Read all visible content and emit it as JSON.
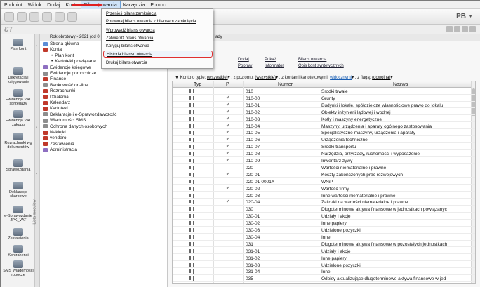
{
  "menubar": {
    "items": [
      {
        "label": "Podmiot"
      },
      {
        "label": "Widok"
      },
      {
        "label": "Dodaj"
      },
      {
        "label": "Konto"
      },
      {
        "label": "Bilans otwarcia",
        "active": true
      },
      {
        "label": "Narzędzia"
      },
      {
        "label": "Pomoc"
      }
    ]
  },
  "toolbar": {
    "profile_label": "PB"
  },
  "context": {
    "year_label": "Rok obrotowy - 2021  (od 0",
    "trail": "ady"
  },
  "modules": [
    {
      "label": "Plan kont",
      "icon": "chart-of-accounts-icon"
    },
    {
      "label": "Dekretacja i księgowanie",
      "icon": "posting-icon"
    },
    {
      "label": "Ewidencja VAT sprzedaży",
      "icon": "vat-sales-icon"
    },
    {
      "label": "Ewidencja VAT zakupu",
      "icon": "vat-purchase-icon"
    },
    {
      "label": "Rozrachunki wg dokumentów",
      "icon": "settlements-icon"
    },
    {
      "label": "Sprawozdania",
      "icon": "reports-icon"
    },
    {
      "label": "Deklaracje skarbowe",
      "icon": "tax-declarations-icon"
    },
    {
      "label": "e-Sprawozdanie JPK_VAT",
      "icon": "e-report-icon"
    },
    {
      "label": "Zestawienia",
      "icon": "summaries-icon"
    },
    {
      "label": "Kontrahenci",
      "icon": "contractors-icon"
    },
    {
      "label": "SMS Wiadomości robocze",
      "icon": "sms-icon"
    }
  ],
  "module_tab_label": "Lista modułów",
  "tree": {
    "items": [
      {
        "label": "Strona główna",
        "indent": 0,
        "color": "#5b8dd6"
      },
      {
        "label": "Konta",
        "indent": 0,
        "color": "#c0392b"
      },
      {
        "label": "Plan kont",
        "indent": 2,
        "color": ""
      },
      {
        "label": "Kartoteki powiązane",
        "indent": 2,
        "color": ""
      },
      {
        "label": "Ewidencje księgowe",
        "indent": 0,
        "color": "#8e6fc1"
      },
      {
        "label": "Ewidencje pomocnicze",
        "indent": 0,
        "color": "#8e8e8e"
      },
      {
        "label": "Finanse",
        "indent": 0,
        "color": "#c0392b"
      },
      {
        "label": "Bankowość on-line",
        "indent": 0,
        "color": "#8e8e8e"
      },
      {
        "label": "Rozrachunki",
        "indent": 0,
        "color": "#c0392b"
      },
      {
        "label": "Działania",
        "indent": 0,
        "color": "#c0392b"
      },
      {
        "label": "Kalendarz",
        "indent": 0,
        "color": "#c0392b"
      },
      {
        "label": "Kartoteki",
        "indent": 0,
        "color": "#c0392b"
      },
      {
        "label": "Deklaracje i e-Sprawozdawczość",
        "indent": 0,
        "color": "#8e8e8e"
      },
      {
        "label": "Wiadomości SMS",
        "indent": 0,
        "color": "#8e8e8e"
      },
      {
        "label": "Ochrona danych osobowych",
        "indent": 0,
        "color": "#8e8e8e"
      },
      {
        "label": "Naklejki",
        "indent": 0,
        "color": "#c0392b"
      },
      {
        "label": "vendero",
        "indent": 0,
        "color": "#c0392b"
      },
      {
        "label": "Zestawienia",
        "indent": 0,
        "color": "#c0392b"
      },
      {
        "label": "Administracja",
        "indent": 0,
        "color": "#8e6fc1"
      }
    ]
  },
  "actions": {
    "dodaj": "Dodaj",
    "popraw": "Popraw",
    "pokaz": "Pokaż",
    "informator": "Informator",
    "bilans_otwarcia": "Bilans otwarcia",
    "opis_kont": "Opis kont syntetycznych"
  },
  "filter": {
    "label_type": "Konto o typie:",
    "type_value": "(wszystkie)",
    "label_level": ", z poziomu:",
    "level_value": "(wszystkie)",
    "label_card": ", z kontami kartotekowymi:",
    "card_value": "widocznymi",
    "label_flag": ", z flagą:",
    "flag_value": "(dowolna)"
  },
  "grid": {
    "columns": {
      "typ": "Typ",
      "p": "P",
      "numer": "Numer",
      "nazwa": "Nazwa"
    },
    "rows": [
      {
        "checked": false,
        "numer": "010",
        "nazwa": "Środki trwałe"
      },
      {
        "checked": true,
        "numer": "010-00",
        "nazwa": "Grunty"
      },
      {
        "checked": true,
        "numer": "010-01",
        "nazwa": "Budynki i lokale, spółdzielcze własnościowe prawo do lokalu"
      },
      {
        "checked": true,
        "numer": "010-02",
        "nazwa": "Obiekty inżynierii lądowej i wodnej"
      },
      {
        "checked": true,
        "numer": "010-03",
        "nazwa": "Kotły i maszyny energetyczne"
      },
      {
        "checked": true,
        "numer": "010-04",
        "nazwa": "Maszyny, urządzenia i aparaty ogólnego zastosowania"
      },
      {
        "checked": true,
        "numer": "010-05",
        "nazwa": "Specjalistyczne maszyny, urządzenia i aparaty"
      },
      {
        "checked": true,
        "numer": "010-06",
        "nazwa": "Urządzenia techniczne"
      },
      {
        "checked": true,
        "numer": "010-07",
        "nazwa": "Środki transportu"
      },
      {
        "checked": true,
        "numer": "010-08",
        "nazwa": "Narzędzia, przyrządy, ruchomości i wyposażenie"
      },
      {
        "checked": true,
        "numer": "010-09",
        "nazwa": "Inwentarz żywy"
      },
      {
        "checked": false,
        "numer": "020",
        "nazwa": "Wartości niematerialne i prawne"
      },
      {
        "checked": true,
        "numer": "020-01",
        "nazwa": "Koszty zakończonych prac rozwojowych"
      },
      {
        "checked": false,
        "numer": "020-01-0001X",
        "nazwa": "WNiP"
      },
      {
        "checked": true,
        "numer": "020-02",
        "nazwa": "Wartość firmy"
      },
      {
        "checked": false,
        "numer": "020-03",
        "nazwa": "Inne wartości niematerialne i prawne"
      },
      {
        "checked": true,
        "numer": "020-04",
        "nazwa": "Zaliczki na wartości niematerialne i prawne"
      },
      {
        "checked": false,
        "numer": "030",
        "nazwa": "Długoterminowe aktywa finansowe w jednostkach powiązanyc"
      },
      {
        "checked": false,
        "numer": "030-01",
        "nazwa": "Udziały i akcje"
      },
      {
        "checked": false,
        "numer": "030-02",
        "nazwa": "Inne papiery"
      },
      {
        "checked": false,
        "numer": "030-03",
        "nazwa": "Udzielone pożyczki"
      },
      {
        "checked": false,
        "numer": "030-04",
        "nazwa": "Inne"
      },
      {
        "checked": false,
        "numer": "031",
        "nazwa": "Długoterminowe aktywa finansowe w pozostałych jednostkach"
      },
      {
        "checked": false,
        "numer": "031-01",
        "nazwa": "Udziały i akcje"
      },
      {
        "checked": false,
        "numer": "031-02",
        "nazwa": "Inne papiery"
      },
      {
        "checked": false,
        "numer": "031-03",
        "nazwa": "Udzielone pożyczki"
      },
      {
        "checked": false,
        "numer": "031-04",
        "nazwa": "Inne"
      },
      {
        "checked": false,
        "numer": "035",
        "nazwa": "Odpisy aktualizujące długoterminowe aktywa finansowe w jed"
      }
    ]
  },
  "dropdown": {
    "items": [
      {
        "label": "Przenieś bilans zamknięcia"
      },
      {
        "label": "Porównaj bilans otwarcia z bilansem zamknięcia"
      },
      {
        "label": "Wprowadź bilans otwarcia"
      },
      {
        "label": "Zatwierdź bilans otwarcia"
      },
      {
        "label": "Koryguj bilans otwarcia"
      },
      {
        "label": "Historia bilansu otwarcia",
        "highlighted": true
      },
      {
        "label": "Drukuj bilans otwarcia"
      }
    ]
  },
  "colors": {
    "highlight": "#e03030",
    "arrow": "#e02020",
    "link_blue": "#1a5fb4"
  }
}
